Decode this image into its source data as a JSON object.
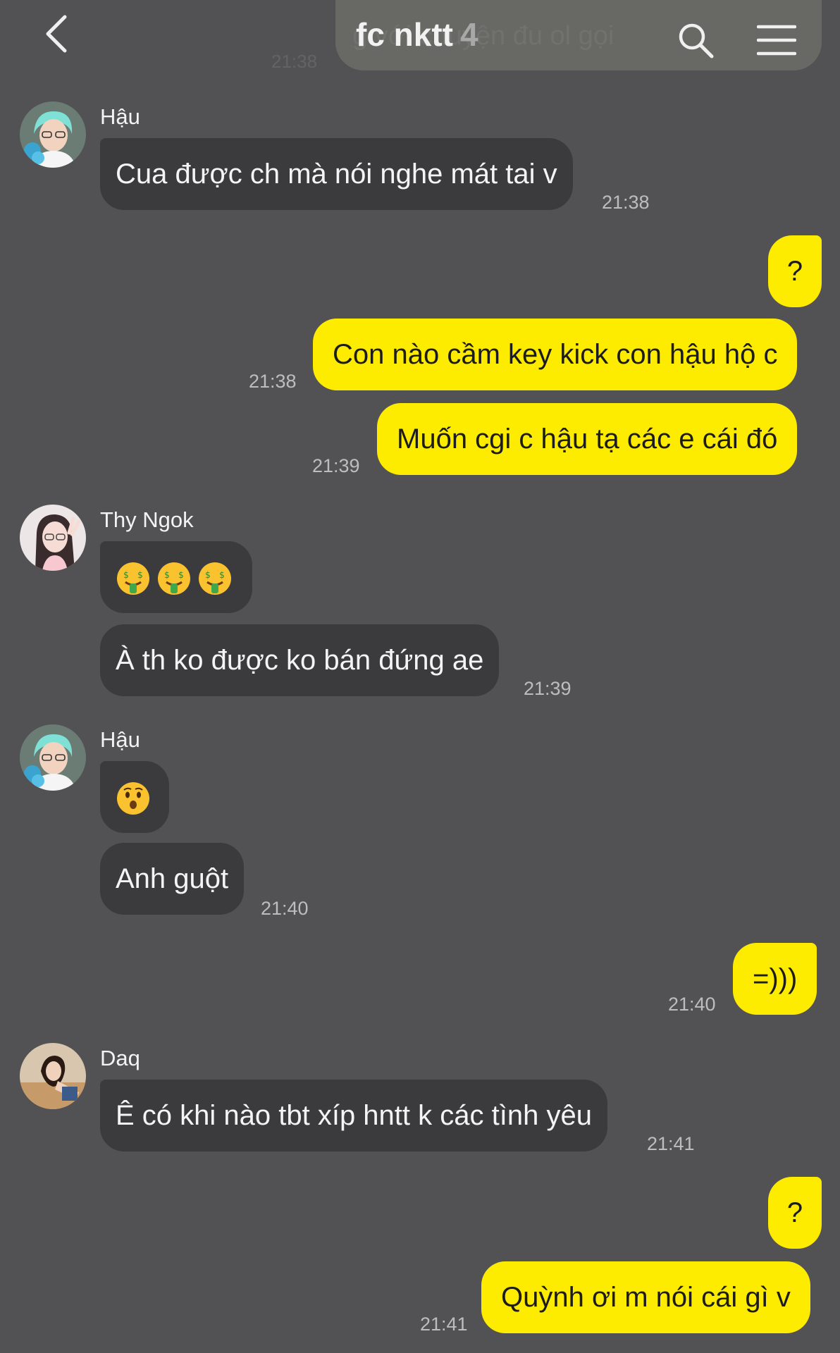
{
  "header": {
    "title": "fc nktt",
    "member_count": "4",
    "back_icon": "chevron-left-icon",
    "search_icon": "search-icon",
    "menu_icon": "hamburger-menu-icon",
    "ghost_text": "g     với chuyện đu   ol   gọi",
    "ghost_time": "21:38"
  },
  "colors": {
    "background": "#525254",
    "incoming_bubble": "#3b3b3d",
    "outgoing_bubble": "#fdeb00"
  },
  "messages": [
    {
      "sender": "Hậu",
      "text": "Cua được ch mà nói nghe mát tai v",
      "time": "21:38"
    },
    {
      "sender": "me",
      "text": "?",
      "time": ""
    },
    {
      "sender": "me",
      "text": "Con nào cầm key kick con hậu hộ c",
      "time": "21:38"
    },
    {
      "sender": "me",
      "text": "Muốn cgi c hậu tạ các e cái đó",
      "time": "21:39"
    },
    {
      "sender": "Thy Ngok",
      "emoji": [
        "money-mouth-face",
        "money-mouth-face",
        "money-mouth-face"
      ],
      "time": ""
    },
    {
      "sender": "Thy Ngok",
      "text": "À th ko được ko bán đứng ae",
      "time": "21:39"
    },
    {
      "sender": "Hậu",
      "emoji": [
        "hushed-face"
      ],
      "time": ""
    },
    {
      "sender": "Hậu",
      "text": "Anh guột",
      "time": "21:40"
    },
    {
      "sender": "me",
      "text": "=)))",
      "time": "21:40"
    },
    {
      "sender": "Daq",
      "text": "Ê có khi nào tbt xíp hntt k các tình yêu",
      "time": "21:41"
    },
    {
      "sender": "me",
      "text": "?",
      "time": ""
    },
    {
      "sender": "me",
      "text": "Quỳnh ơi m nói cái gì v",
      "time": "21:41"
    }
  ]
}
